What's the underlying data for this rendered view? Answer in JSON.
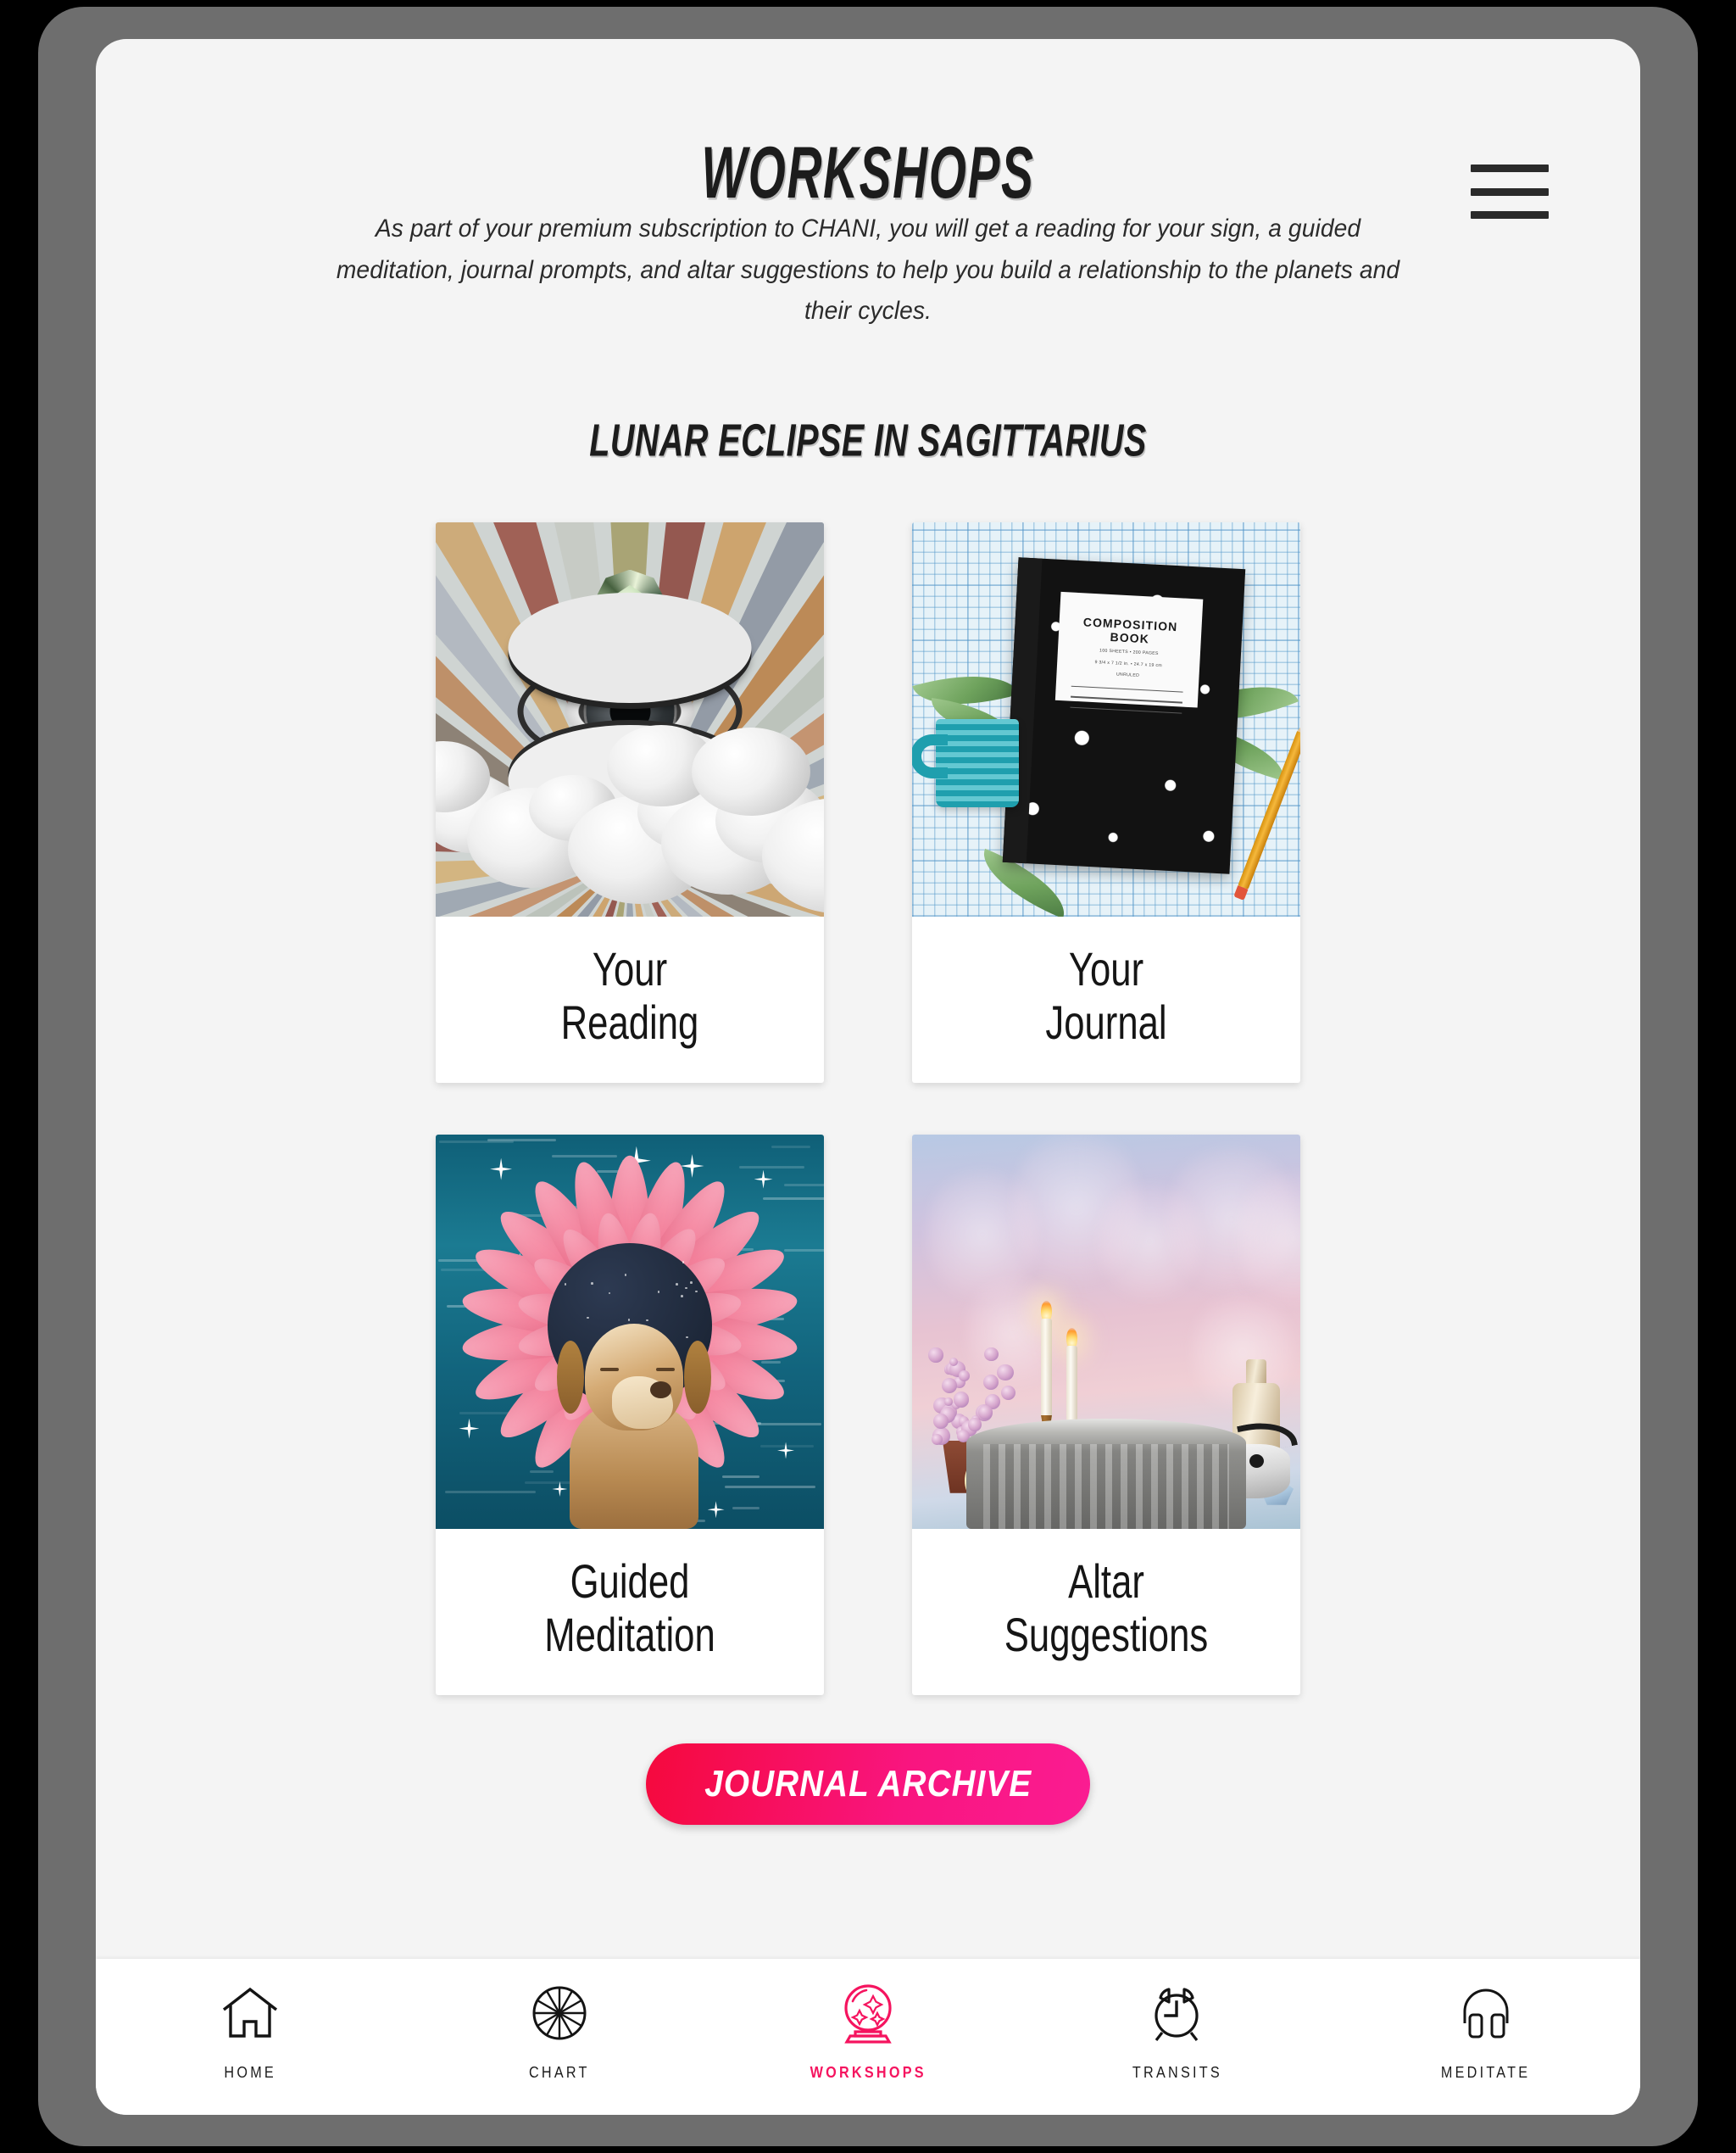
{
  "header": {
    "title": "WORKSHOPS",
    "menu_icon": "hamburger-menu-icon"
  },
  "intro": {
    "text": "As part of your premium subscription to CHANI, you will get a reading for your sign, a guided meditation, journal prompts, and altar suggestions to help you build a relationship to the planets and their cycles."
  },
  "section": {
    "title": "LUNAR ECLIPSE IN SAGITTARIUS"
  },
  "cards": [
    {
      "label": "Your\nReading",
      "art": "sunburst-eye-clouds-collage"
    },
    {
      "label": "Your\nJournal",
      "art": "composition-book-collage",
      "book_title": "COMPOSITION BOOK",
      "book_sub1": "100 SHEETS • 200 PAGES",
      "book_sub2": "9 3/4 x 7 1/2 in. • 24.7 x 19 cm",
      "book_sub3": "UNRULED"
    },
    {
      "label": "Guided\nMeditation",
      "art": "dog-dahlia-ocean-collage"
    },
    {
      "label": "Altar\nSuggestions",
      "art": "altar-still-life-collage"
    }
  ],
  "cta": {
    "journal_archive_label": "JOURNAL ARCHIVE"
  },
  "nav": {
    "items": [
      {
        "label": "HOME",
        "icon": "house-icon",
        "active": false
      },
      {
        "label": "CHART",
        "icon": "chart-wheel-icon",
        "active": false
      },
      {
        "label": "WORKSHOPS",
        "icon": "crystal-ball-icon",
        "active": true
      },
      {
        "label": "TRANSITS",
        "icon": "alarm-clock-icon",
        "active": false
      },
      {
        "label": "MEDITATE",
        "icon": "headphones-icon",
        "active": false
      }
    ]
  },
  "colors": {
    "accent_pink": "#f5145f",
    "cta_gradient_start": "#f5093d",
    "cta_gradient_end": "#fa1c92",
    "screen_bg": "#f4f4f4",
    "device_bezel": "#6e6e6e",
    "text_dark": "#1c1c1c"
  }
}
